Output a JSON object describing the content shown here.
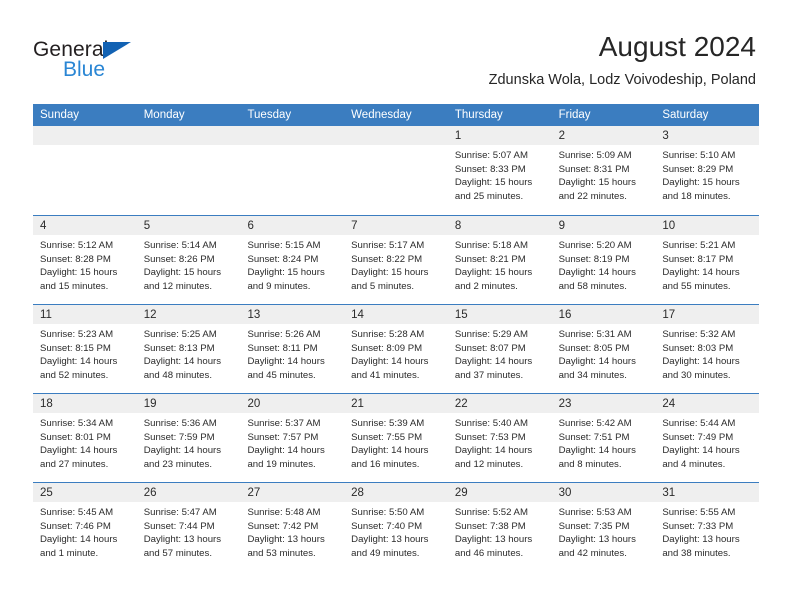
{
  "brand": {
    "name_dark": "General",
    "name_blue": "Blue",
    "triangle_icon": "triangle-icon",
    "colors": {
      "dark": "#231f20",
      "blue": "#2a86d4",
      "triangle": "#1262b3"
    }
  },
  "header": {
    "title": "August 2024",
    "subtitle": "Zdunska Wola, Lodz Voivodeship, Poland"
  },
  "colors": {
    "header_row_bg": "#3b7dc0",
    "daynum_band_bg": "#efefef",
    "text": "#2b2b2b",
    "page_bg": "#ffffff"
  },
  "calendar": {
    "weekday_headers": [
      "Sunday",
      "Monday",
      "Tuesday",
      "Wednesday",
      "Thursday",
      "Friday",
      "Saturday"
    ],
    "weeks": [
      [
        {
          "day": "",
          "lines": []
        },
        {
          "day": "",
          "lines": []
        },
        {
          "day": "",
          "lines": []
        },
        {
          "day": "",
          "lines": []
        },
        {
          "day": "1",
          "lines": [
            "Sunrise: 5:07 AM",
            "Sunset: 8:33 PM",
            "Daylight: 15 hours",
            "and 25 minutes."
          ]
        },
        {
          "day": "2",
          "lines": [
            "Sunrise: 5:09 AM",
            "Sunset: 8:31 PM",
            "Daylight: 15 hours",
            "and 22 minutes."
          ]
        },
        {
          "day": "3",
          "lines": [
            "Sunrise: 5:10 AM",
            "Sunset: 8:29 PM",
            "Daylight: 15 hours",
            "and 18 minutes."
          ]
        }
      ],
      [
        {
          "day": "4",
          "lines": [
            "Sunrise: 5:12 AM",
            "Sunset: 8:28 PM",
            "Daylight: 15 hours",
            "and 15 minutes."
          ]
        },
        {
          "day": "5",
          "lines": [
            "Sunrise: 5:14 AM",
            "Sunset: 8:26 PM",
            "Daylight: 15 hours",
            "and 12 minutes."
          ]
        },
        {
          "day": "6",
          "lines": [
            "Sunrise: 5:15 AM",
            "Sunset: 8:24 PM",
            "Daylight: 15 hours",
            "and 9 minutes."
          ]
        },
        {
          "day": "7",
          "lines": [
            "Sunrise: 5:17 AM",
            "Sunset: 8:22 PM",
            "Daylight: 15 hours",
            "and 5 minutes."
          ]
        },
        {
          "day": "8",
          "lines": [
            "Sunrise: 5:18 AM",
            "Sunset: 8:21 PM",
            "Daylight: 15 hours",
            "and 2 minutes."
          ]
        },
        {
          "day": "9",
          "lines": [
            "Sunrise: 5:20 AM",
            "Sunset: 8:19 PM",
            "Daylight: 14 hours",
            "and 58 minutes."
          ]
        },
        {
          "day": "10",
          "lines": [
            "Sunrise: 5:21 AM",
            "Sunset: 8:17 PM",
            "Daylight: 14 hours",
            "and 55 minutes."
          ]
        }
      ],
      [
        {
          "day": "11",
          "lines": [
            "Sunrise: 5:23 AM",
            "Sunset: 8:15 PM",
            "Daylight: 14 hours",
            "and 52 minutes."
          ]
        },
        {
          "day": "12",
          "lines": [
            "Sunrise: 5:25 AM",
            "Sunset: 8:13 PM",
            "Daylight: 14 hours",
            "and 48 minutes."
          ]
        },
        {
          "day": "13",
          "lines": [
            "Sunrise: 5:26 AM",
            "Sunset: 8:11 PM",
            "Daylight: 14 hours",
            "and 45 minutes."
          ]
        },
        {
          "day": "14",
          "lines": [
            "Sunrise: 5:28 AM",
            "Sunset: 8:09 PM",
            "Daylight: 14 hours",
            "and 41 minutes."
          ]
        },
        {
          "day": "15",
          "lines": [
            "Sunrise: 5:29 AM",
            "Sunset: 8:07 PM",
            "Daylight: 14 hours",
            "and 37 minutes."
          ]
        },
        {
          "day": "16",
          "lines": [
            "Sunrise: 5:31 AM",
            "Sunset: 8:05 PM",
            "Daylight: 14 hours",
            "and 34 minutes."
          ]
        },
        {
          "day": "17",
          "lines": [
            "Sunrise: 5:32 AM",
            "Sunset: 8:03 PM",
            "Daylight: 14 hours",
            "and 30 minutes."
          ]
        }
      ],
      [
        {
          "day": "18",
          "lines": [
            "Sunrise: 5:34 AM",
            "Sunset: 8:01 PM",
            "Daylight: 14 hours",
            "and 27 minutes."
          ]
        },
        {
          "day": "19",
          "lines": [
            "Sunrise: 5:36 AM",
            "Sunset: 7:59 PM",
            "Daylight: 14 hours",
            "and 23 minutes."
          ]
        },
        {
          "day": "20",
          "lines": [
            "Sunrise: 5:37 AM",
            "Sunset: 7:57 PM",
            "Daylight: 14 hours",
            "and 19 minutes."
          ]
        },
        {
          "day": "21",
          "lines": [
            "Sunrise: 5:39 AM",
            "Sunset: 7:55 PM",
            "Daylight: 14 hours",
            "and 16 minutes."
          ]
        },
        {
          "day": "22",
          "lines": [
            "Sunrise: 5:40 AM",
            "Sunset: 7:53 PM",
            "Daylight: 14 hours",
            "and 12 minutes."
          ]
        },
        {
          "day": "23",
          "lines": [
            "Sunrise: 5:42 AM",
            "Sunset: 7:51 PM",
            "Daylight: 14 hours",
            "and 8 minutes."
          ]
        },
        {
          "day": "24",
          "lines": [
            "Sunrise: 5:44 AM",
            "Sunset: 7:49 PM",
            "Daylight: 14 hours",
            "and 4 minutes."
          ]
        }
      ],
      [
        {
          "day": "25",
          "lines": [
            "Sunrise: 5:45 AM",
            "Sunset: 7:46 PM",
            "Daylight: 14 hours",
            "and 1 minute."
          ]
        },
        {
          "day": "26",
          "lines": [
            "Sunrise: 5:47 AM",
            "Sunset: 7:44 PM",
            "Daylight: 13 hours",
            "and 57 minutes."
          ]
        },
        {
          "day": "27",
          "lines": [
            "Sunrise: 5:48 AM",
            "Sunset: 7:42 PM",
            "Daylight: 13 hours",
            "and 53 minutes."
          ]
        },
        {
          "day": "28",
          "lines": [
            "Sunrise: 5:50 AM",
            "Sunset: 7:40 PM",
            "Daylight: 13 hours",
            "and 49 minutes."
          ]
        },
        {
          "day": "29",
          "lines": [
            "Sunrise: 5:52 AM",
            "Sunset: 7:38 PM",
            "Daylight: 13 hours",
            "and 46 minutes."
          ]
        },
        {
          "day": "30",
          "lines": [
            "Sunrise: 5:53 AM",
            "Sunset: 7:35 PM",
            "Daylight: 13 hours",
            "and 42 minutes."
          ]
        },
        {
          "day": "31",
          "lines": [
            "Sunrise: 5:55 AM",
            "Sunset: 7:33 PM",
            "Daylight: 13 hours",
            "and 38 minutes."
          ]
        }
      ]
    ]
  }
}
